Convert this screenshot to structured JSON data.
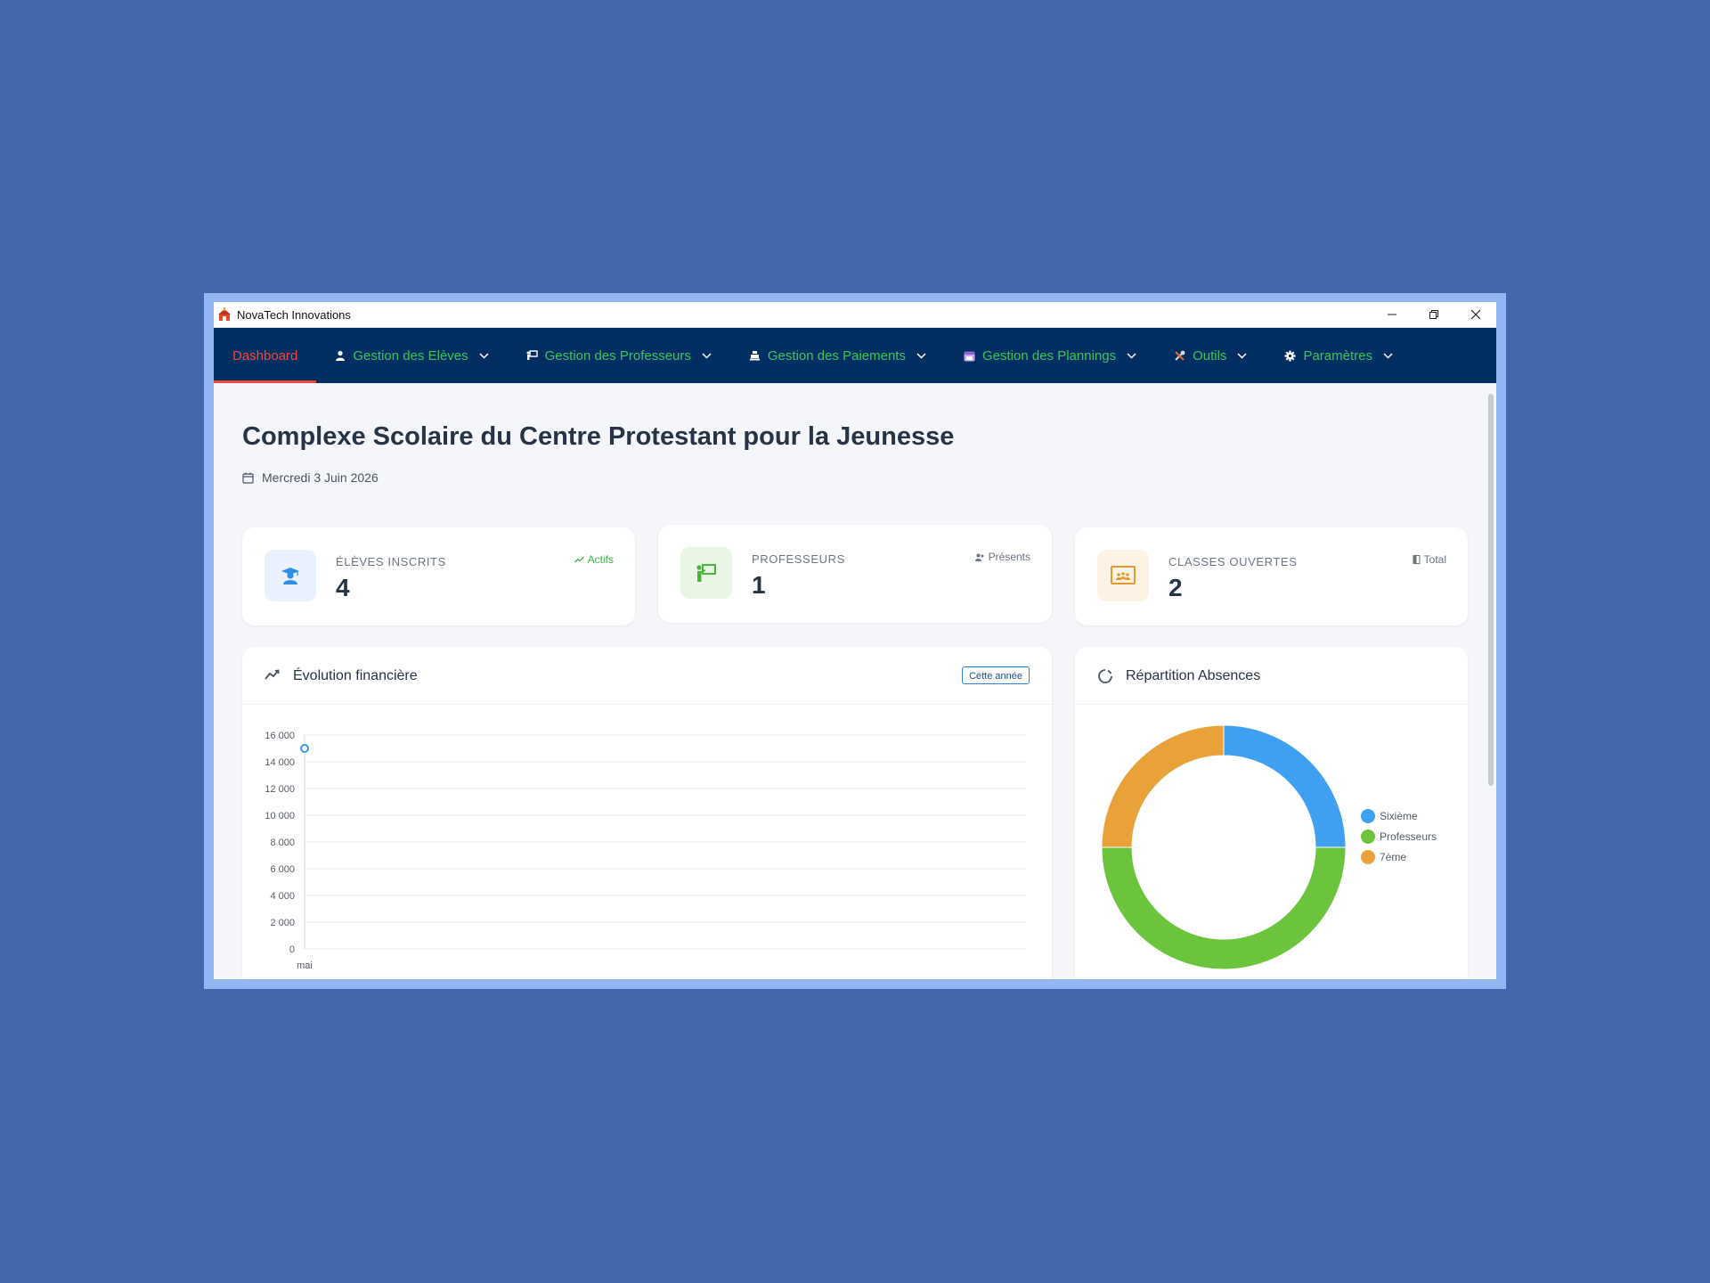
{
  "window": {
    "title": "NovaTech Innovations"
  },
  "nav": {
    "items": [
      {
        "label": "Dashboard",
        "icon": "none",
        "active": true
      },
      {
        "label": "Gestion des Elèves",
        "icon": "student-icon"
      },
      {
        "label": "Gestion des Professeurs",
        "icon": "teacher-board-icon"
      },
      {
        "label": "Gestion des Paiements",
        "icon": "cash-register-icon"
      },
      {
        "label": "Gestion des Plannings",
        "icon": "calendar-icon"
      },
      {
        "label": "Outils",
        "icon": "tools-icon"
      },
      {
        "label": "Paramètres",
        "icon": "gear-icon"
      }
    ]
  },
  "header": {
    "title": "Complexe Scolaire du Centre Protestant pour la Jeunesse",
    "date": "Mercredi 3 Juin 2026"
  },
  "stats": [
    {
      "label": "ÉLÈVES INSCRITS",
      "value": "4",
      "tag": "Actifs",
      "tag_color": "#3fb24a",
      "icon": "student-cap-icon",
      "icon_bg": "#e8f1fd",
      "icon_color": "#2f8fe8"
    },
    {
      "label": "PROFESSEURS",
      "value": "1",
      "tag": "Présents",
      "tag_color": "#6b7482",
      "icon": "teacher-board-icon",
      "icon_bg": "#e9f6e6",
      "icon_color": "#4cb43a"
    },
    {
      "label": "CLASSES OUVERTES",
      "value": "2",
      "tag": "Total",
      "tag_color": "#6b7482",
      "icon": "classroom-icon",
      "icon_bg": "#fdf3e5",
      "icon_color": "#e59a30"
    }
  ],
  "finance_panel": {
    "title": "Évolution financière",
    "filter_label": "Cette année"
  },
  "absence_panel": {
    "title": "Répartition Absences"
  },
  "chart_data": [
    {
      "type": "line",
      "title": "Évolution financière",
      "x": [
        "mai"
      ],
      "series": [
        {
          "values": [
            15000
          ]
        }
      ],
      "ylim": [
        0,
        16000
      ],
      "yticks": [
        "16 000",
        "14 000",
        "12 000",
        "10 000",
        "8 000",
        "6 000",
        "4 000",
        "2 000",
        "0"
      ],
      "grid": true,
      "color": "#3b93e6"
    },
    {
      "type": "pie",
      "title": "Répartition Absences",
      "donut": true,
      "categories": [
        "Sixième",
        "Professeurs",
        "7ème"
      ],
      "values": [
        25,
        50,
        25
      ],
      "colors": [
        "#3f9ff0",
        "#6cc43c",
        "#e9a23a"
      ],
      "legend": "right"
    }
  ]
}
